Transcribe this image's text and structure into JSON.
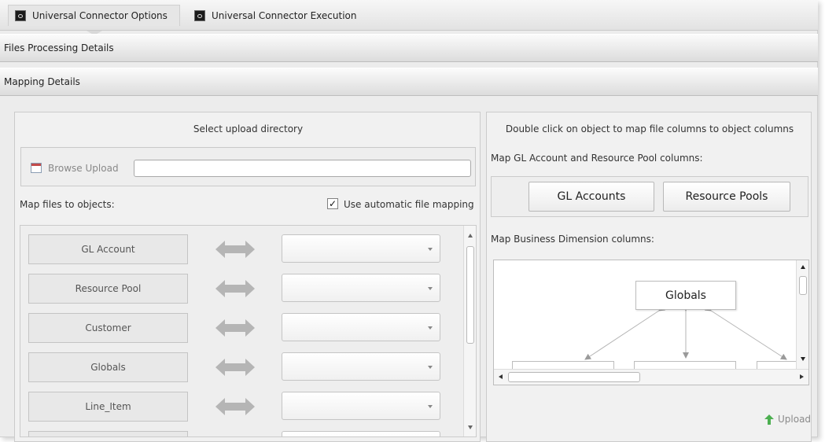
{
  "tabs": [
    {
      "label": "Universal Connector Options",
      "active": true
    },
    {
      "label": "Universal Connector Execution",
      "active": false
    }
  ],
  "sections": {
    "files_processing": "Files Processing Details",
    "mapping": "Mapping Details"
  },
  "left": {
    "directory_title": "Select upload directory",
    "browse_label": "Browse Upload",
    "directory_value": "",
    "map_files_label": "Map files to objects:",
    "auto_mapping_label": "Use automatic file mapping",
    "auto_mapping_checked": true,
    "auto_mapping_mark": "✓",
    "objects": [
      {
        "name": "GL Account",
        "selected": ""
      },
      {
        "name": "Resource Pool",
        "selected": ""
      },
      {
        "name": "Customer",
        "selected": ""
      },
      {
        "name": "Globals",
        "selected": ""
      },
      {
        "name": "Line_Item",
        "selected": ""
      }
    ]
  },
  "right": {
    "instruction": "Double click on object to map file columns to object columns",
    "gl_rp_label": "Map GL Account and Resource Pool columns:",
    "gl_accounts_button": "GL Accounts",
    "resource_pools_button": "Resource Pools",
    "business_dim_label": "Map Business Dimension columns:",
    "diagram_root": "Globals",
    "upload_label": "Upload"
  },
  "colors": {
    "accent_upload_icon": "#4caf50",
    "calendar_icon": "#c24a4a",
    "mapping_arrow": "#b5b5b5"
  }
}
